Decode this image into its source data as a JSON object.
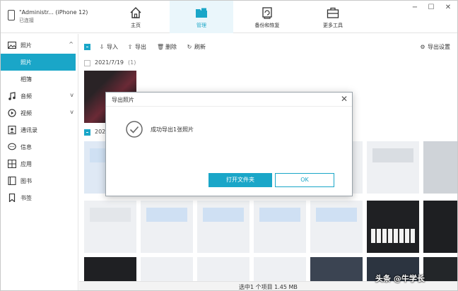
{
  "device": {
    "name": "\"Administr... (iPhone 12)",
    "status": "已连接"
  },
  "tabs": [
    {
      "label": "主页",
      "icon": "home-icon"
    },
    {
      "label": "管理",
      "icon": "folder-icon"
    },
    {
      "label": "备份和恢复",
      "icon": "backup-icon"
    },
    {
      "label": "更多工具",
      "icon": "toolbox-icon"
    }
  ],
  "window_controls": {
    "minimize": "−",
    "maximize": "☐",
    "close": "✕"
  },
  "sidebar": {
    "items": [
      {
        "label": "照片",
        "icon": "photo-icon",
        "chevron": "^"
      },
      {
        "label": "照片",
        "sub": true,
        "active": true
      },
      {
        "label": "相簿",
        "sub": true
      },
      {
        "label": "音频",
        "icon": "music-icon",
        "chevron": "v"
      },
      {
        "label": "视频",
        "icon": "video-icon",
        "chevron": "v"
      },
      {
        "label": "通讯录",
        "icon": "contacts-icon"
      },
      {
        "label": "信息",
        "icon": "message-icon"
      },
      {
        "label": "应用",
        "icon": "apps-icon"
      },
      {
        "label": "图书",
        "icon": "book-icon"
      },
      {
        "label": "书签",
        "icon": "bookmark-icon"
      }
    ]
  },
  "toolbar": {
    "import_label": "导入",
    "export_label": "导出",
    "delete_label": "删除",
    "refresh_label": "刷新",
    "export_settings_label": "导出设置"
  },
  "groups": [
    {
      "date": "2021/7/19",
      "count": "(1)"
    },
    {
      "date": "2021"
    }
  ],
  "status": "选中1 个项目 1.45 MB",
  "dialog": {
    "title": "导出照片",
    "message": "成功导出1张照片",
    "open_folder_label": "打开文件夹",
    "ok_label": "OK"
  },
  "watermark": "头条 @牛学长",
  "colors": {
    "accent": "#1aa6c8",
    "active_tab_bg": "#eaf6fb"
  }
}
